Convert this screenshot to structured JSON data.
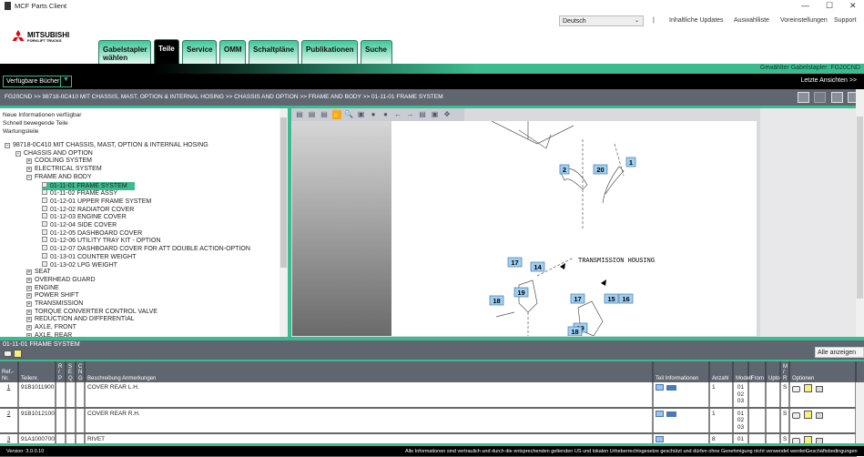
{
  "window": {
    "title": "MCF Parts Client",
    "minimize": "—",
    "maximize": "☐",
    "close": "✕"
  },
  "header": {
    "language": "Deutsch",
    "separator": "|",
    "links": [
      "Inhaltliche Updates",
      "Auswahlliste",
      "Voreinstellungen",
      "Support"
    ],
    "logo_text": "MITSUBISHI",
    "logo_sub": "FORKLIFT TRUCKS"
  },
  "tabs": [
    {
      "label": "Gabelstapler wählen"
    },
    {
      "label": "Teile",
      "active": true
    },
    {
      "label": "Service"
    },
    {
      "label": "OMM"
    },
    {
      "label": "Schaltpläne"
    },
    {
      "label": "Publikationen"
    },
    {
      "label": "Suche"
    }
  ],
  "banner": {
    "selected_forklift": "Gewählter Gabelstapler: FG20CND",
    "books_dropdown": "Verfügbare Bücher",
    "recent_views": "Letzte Ansichten >>"
  },
  "breadcrumb": "FG20CND >> 98718-0C410 MIT CHASSIS, MAST, OPTION & INTERNAL HOSING >> CHASSIS AND OPTION >> FRAME AND BODY >> 01-11-01 FRAME SYSTEM",
  "sidebar": {
    "links": [
      "Neue Informationen verfügbar",
      "Schnell bewegende Teile",
      "Wartungsteile"
    ],
    "tree": [
      {
        "label": "98718-0C410 MIT CHASSIS, MAST, OPTION & INTERNAL HOSING",
        "level": 0,
        "state": "open"
      },
      {
        "label": "CHASSIS AND OPTION",
        "level": 1,
        "state": "open"
      },
      {
        "label": "COOLING SYSTEM",
        "level": 2,
        "state": "closed"
      },
      {
        "label": "ELECTRICAL SYSTEM",
        "level": 2,
        "state": "closed"
      },
      {
        "label": "FRAME AND BODY",
        "level": 2,
        "state": "open"
      },
      {
        "label": "01-11-01 FRAME SYSTEM",
        "level": 3,
        "state": "leaf",
        "selected": true
      },
      {
        "label": "01-11-02 FRAME ASSY",
        "level": 3,
        "state": "leaf"
      },
      {
        "label": "01-12-01 UPPER FRAME SYSTEM",
        "level": 3,
        "state": "leaf"
      },
      {
        "label": "01-12-02 RADIATOR COVER",
        "level": 3,
        "state": "leaf"
      },
      {
        "label": "01-12-03 ENGINE COVER",
        "level": 3,
        "state": "leaf"
      },
      {
        "label": "01-12-04 SIDE COVER",
        "level": 3,
        "state": "leaf"
      },
      {
        "label": "01-12-05 DASHBOARD COVER",
        "level": 3,
        "state": "leaf"
      },
      {
        "label": "01-12-06 UTILITY TRAY KIT - OPTION",
        "level": 3,
        "state": "leaf"
      },
      {
        "label": "01-12-07 DASHBOARD COVER FOR ATT DOUBLE ACTION-OPTION",
        "level": 3,
        "state": "leaf"
      },
      {
        "label": "01-13-01 COUNTER WEIGHT",
        "level": 3,
        "state": "leaf"
      },
      {
        "label": "01-13-02 LPG WEIGHT",
        "level": 3,
        "state": "leaf"
      },
      {
        "label": "SEAT",
        "level": 2,
        "state": "closed"
      },
      {
        "label": "OVERHEAD GUARD",
        "level": 2,
        "state": "closed"
      },
      {
        "label": "ENGINE",
        "level": 2,
        "state": "closed"
      },
      {
        "label": "POWER SHIFT",
        "level": 2,
        "state": "closed"
      },
      {
        "label": "TRANSMISSION",
        "level": 2,
        "state": "closed"
      },
      {
        "label": "TORQUE CONVERTER CONTROL VALVE",
        "level": 2,
        "state": "closed"
      },
      {
        "label": "REDUCTION AND DIFFERENTIAL",
        "level": 2,
        "state": "closed"
      },
      {
        "label": "AXLE, FRONT",
        "level": 2,
        "state": "closed"
      },
      {
        "label": "AXLE, REAR",
        "level": 2,
        "state": "closed"
      }
    ]
  },
  "viewer": {
    "callouts": [
      "1",
      "2",
      "20",
      "17",
      "14",
      "19",
      "18",
      "17",
      "15",
      "16",
      "19",
      "18"
    ],
    "drawing_label": "TRANSMISSION HOUSING"
  },
  "parts": {
    "title": "01-11-01 FRAME SYSTEM",
    "filter": "Alle anzeigen",
    "columns": [
      "Ref.- Nr.",
      "Teilenr.",
      "R / P",
      "S E Q",
      "C N G",
      "Beschreibung Anmerkungen",
      "Teil Informationen",
      "Anzahl",
      "Modell",
      "From",
      "Upto",
      "M / R",
      "Optionen"
    ],
    "rows": [
      {
        "ref": "1",
        "part": "91B1011900",
        "rp": "",
        "seq": "",
        "cng": "",
        "desc": "COVER REAR L.H.",
        "info": [
          "doc",
          "mfp"
        ],
        "qty": "1",
        "model": "01 02 03",
        "from": "",
        "upto": "",
        "mr": "S"
      },
      {
        "ref": "2",
        "part": "91B1012100",
        "rp": "",
        "seq": "",
        "cng": "",
        "desc": "COVER REAR R.H.",
        "info": [
          "doc",
          "mfp"
        ],
        "qty": "1",
        "model": "01 02 03",
        "from": "",
        "upto": "",
        "mr": "S"
      },
      {
        "ref": "3",
        "part": "91A1000700",
        "rp": "",
        "seq": "",
        "cng": "",
        "desc": "RIVET",
        "info": [
          "doc"
        ],
        "qty": "8",
        "model": "01 02",
        "from": "",
        "upto": "",
        "mr": "S"
      }
    ]
  },
  "footer": {
    "version": "Version: 3.0.0.10",
    "notice": "Alle Informationen sind vertraulich und durch die entsprechenden geltenden US und lokalen Urheberrechtsgesetze geschützt und dürfen ohne Genehmigung nicht verwendet werden.",
    "terms": "Geschäftsbedingungen"
  },
  "colors": {
    "accent": "#3dbb90",
    "bar": "#5f6670",
    "black": "#000000"
  }
}
